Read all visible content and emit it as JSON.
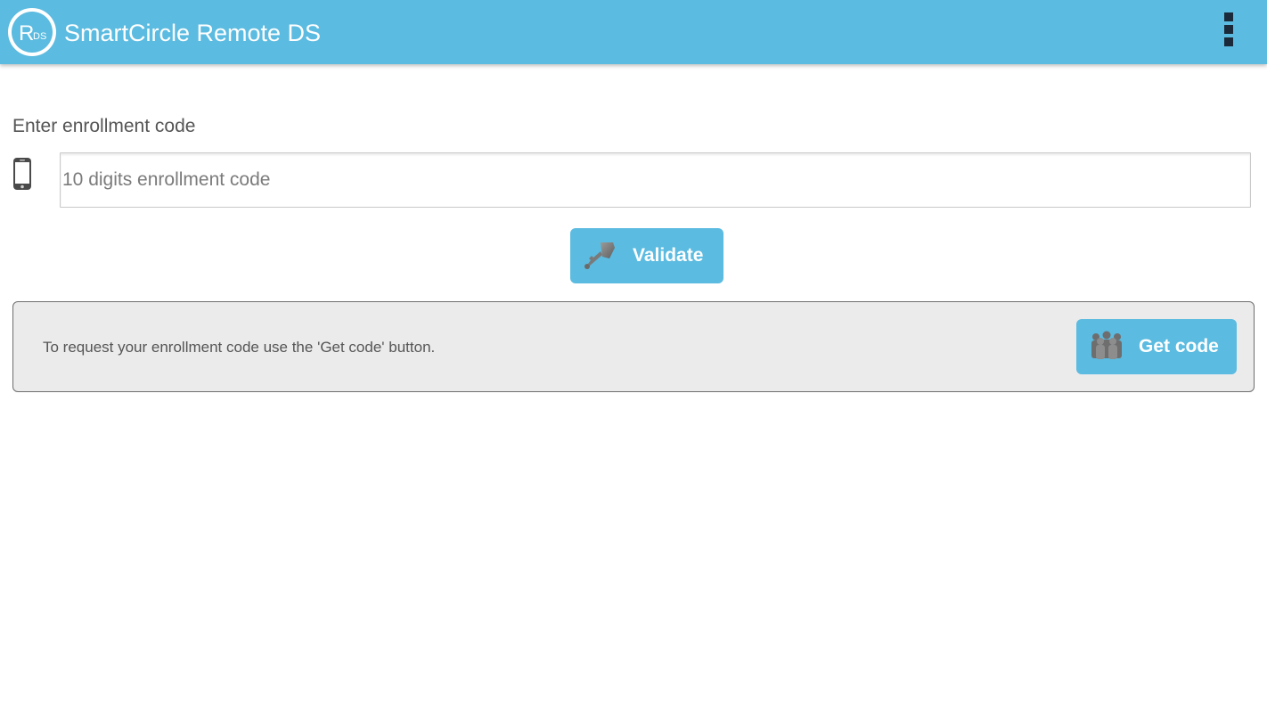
{
  "app_bar": {
    "logo_text": "RDS",
    "title": "SmartCircle Remote DS",
    "menu_icon": "overflow-menu-icon",
    "color": "#5bbbe0"
  },
  "enrollment": {
    "label": "Enter enrollment code",
    "field_icon": "smartphone-icon",
    "input_value": "",
    "input_placeholder": "10 digits enrollment code"
  },
  "validate_button": {
    "label": "Validate",
    "icon": "key-icon"
  },
  "info_panel": {
    "text": "To request your enrollment code use the 'Get code' button.",
    "get_code_button": {
      "label": "Get code",
      "icon": "people-group-icon"
    }
  }
}
